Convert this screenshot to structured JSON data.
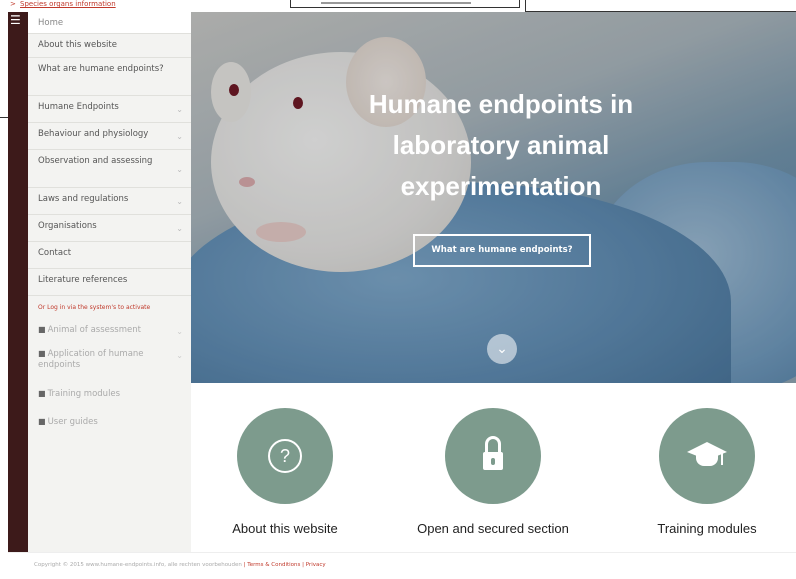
{
  "top": {
    "breadcrumb": "Species organs information"
  },
  "sidebar": {
    "items": [
      {
        "label": "Home"
      },
      {
        "label": "About this website"
      },
      {
        "label": "What are humane endpoints?"
      },
      {
        "label": "Humane Endpoints"
      },
      {
        "label": "Behaviour and physiology"
      },
      {
        "label": "Observation and assessing"
      },
      {
        "label": "Laws and regulations"
      },
      {
        "label": "Organisations"
      },
      {
        "label": "Contact"
      },
      {
        "label": "Literature references"
      }
    ],
    "login_note": "Or Log in via the system's to activate",
    "locked_items": [
      {
        "label": "Animal of assessment"
      },
      {
        "label": "Application of humane endpoints"
      },
      {
        "label": "Training modules"
      },
      {
        "label": "User guides"
      }
    ]
  },
  "hero": {
    "title": "Humane endpoints in laboratory animal experimentation",
    "cta_label": "What are humane endpoints?",
    "down_icon": "chevron-down-icon"
  },
  "features": [
    {
      "label": "About this website",
      "icon": "question-icon"
    },
    {
      "label": "Open and secured section",
      "icon": "lock-icon"
    },
    {
      "label": "Training modules",
      "icon": "graduation-cap-icon"
    }
  ],
  "footer": {
    "copyright": "Copyright © 2015 www.humane-endpoints.info, alle rechten voorbehouden",
    "links": "| Terms & Conditions | Privacy"
  },
  "colors": {
    "accent": "#7d9b8d",
    "sidebar_dark": "#3d1a1a",
    "link_red": "#c0392b"
  }
}
